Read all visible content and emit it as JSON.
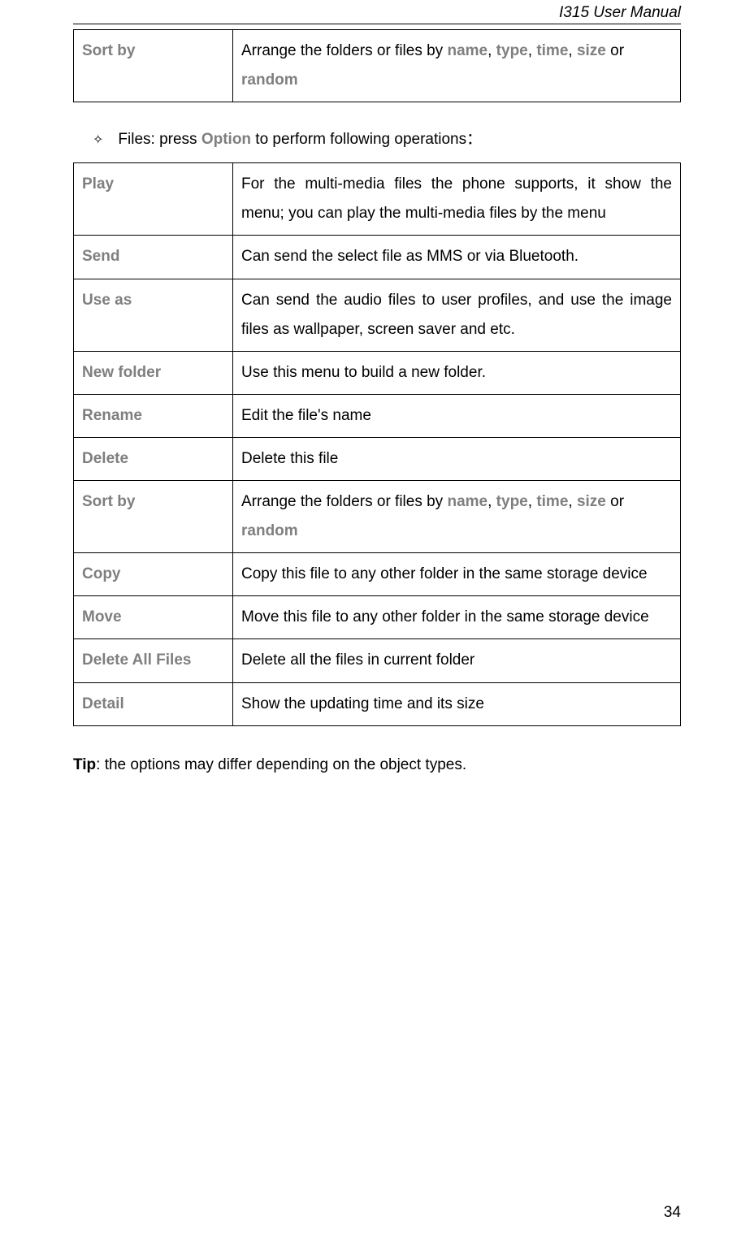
{
  "header": {
    "title": "I315 User Manual"
  },
  "table1_rows": [
    {
      "label": "Sort by",
      "desc_pre": "Arrange the folders or files by ",
      "k1": "name",
      "c1": ", ",
      "k2": "type",
      "c2": ", ",
      "k3": "time",
      "c3": ", ",
      "k4": "size",
      "c4": " or ",
      "k5": "random",
      "has_keywords": true
    }
  ],
  "bullet": {
    "icon": "✧",
    "pre_text": "Files: press ",
    "key": "Option",
    "post_text": " to perform following operations："
  },
  "table2_rows": [
    {
      "label": "Play",
      "desc_plain": "For the multi-media files the phone supports, it show the menu; you can play the multi-media files by the menu",
      "has_keywords": false,
      "justify": true
    },
    {
      "label": "Send",
      "desc_plain": "Can send the select file as MMS or via Bluetooth.",
      "has_keywords": false
    },
    {
      "label": "Use as",
      "desc_plain": "Can send the audio files to user profiles, and use the image files as wallpaper, screen saver and etc.",
      "has_keywords": false,
      "justify": true
    },
    {
      "label": "New folder",
      "desc_plain": "Use this menu to build a new folder.",
      "has_keywords": false
    },
    {
      "label": "Rename",
      "desc_plain": "Edit the file's name",
      "has_keywords": false
    },
    {
      "label": "Delete",
      "desc_plain": "Delete this file",
      "has_keywords": false
    },
    {
      "label": "Sort by",
      "desc_pre": "Arrange the folders or files by ",
      "k1": "name",
      "c1": ", ",
      "k2": "type",
      "c2": ", ",
      "k3": "time",
      "c3": ", ",
      "k4": "size",
      "c4": " or ",
      "k5": "random",
      "has_keywords": true
    },
    {
      "label": "Copy",
      "desc_plain": "Copy this file to any other folder in the same storage device",
      "has_keywords": false
    },
    {
      "label": "Move",
      "desc_plain": "Move this file to any other folder in the same storage device",
      "has_keywords": false
    },
    {
      "label": "Delete All Files",
      "desc_plain": "Delete all the files in current folder",
      "has_keywords": false
    },
    {
      "label": "Detail",
      "desc_plain": "Show the updating time and its size",
      "has_keywords": false
    }
  ],
  "tip": {
    "bold": "Tip",
    "text": ": the options may differ depending on the object types."
  },
  "page_number": "34"
}
